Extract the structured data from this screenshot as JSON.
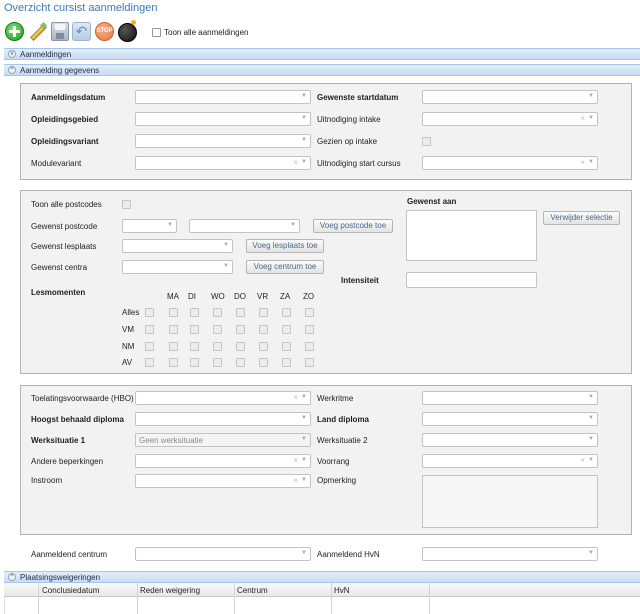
{
  "title": "Overzicht cursist aanmeldingen",
  "toolbar": {
    "icons": [
      "add-icon",
      "edit-icon",
      "save-icon",
      "undo-icon",
      "stop-icon",
      "bomb-icon"
    ],
    "stop_label": "STOP",
    "show_all_label": "Toon alle aanmeldingen"
  },
  "sections": {
    "aanmeldingen": "Aanmeldingen",
    "gegevens": "Aanmelding gegevens",
    "weigeringen": "Plaatsingsweigeringen"
  },
  "panel1": {
    "aanmeldingsdatum": "Aanmeldingsdatum",
    "opleidingsgebied": "Opleidingsgebied",
    "opleidingsvariant": "Opleidingsvariant",
    "modulevariant": "Modulevariant",
    "gewenste_startdatum": "Gewenste startdatum",
    "uitnodiging_intake": "Uitnodiging intake",
    "gezien_op_intake": "Gezien op intake",
    "uitnodiging_start": "Uitnodiging start cursus"
  },
  "panel2": {
    "toon_alle_postcodes": "Toon alle postcodes",
    "gewenst_postcode": "Gewenst postcode",
    "gewenst_lesplaats": "Gewenst lesplaats",
    "gewenst_centra": "Gewenst centra",
    "voeg_postcode": "Voeg postcode toe",
    "voeg_lesplaats": "Voeg lesplaats toe",
    "voeg_centrum": "Voeg centrum toe",
    "gewenst_aan": "Gewenst aan",
    "verwijder": "Verwijder selectie",
    "intensiteit": "Intensiteit",
    "lesmomenten": "Lesmomenten",
    "days": [
      "MA",
      "DI",
      "WO",
      "DO",
      "VR",
      "ZA",
      "ZO"
    ],
    "rows": [
      "Alles",
      "VM",
      "NM",
      "AV"
    ]
  },
  "panel3": {
    "toelatingsvoorwaarde": "Toelatingsvoorwaarde (HBO)",
    "hoogst_diploma": "Hoogst behaald diploma",
    "werksituatie1": "Werksituatie 1",
    "werksituatie1_value": "Geen werksituatie",
    "andere_beperkingen": "Andere beperkingen",
    "instroom": "Instroom",
    "werkritme": "Werkritme",
    "land_diploma": "Land diploma",
    "werksituatie2": "Werksituatie 2",
    "voorrang": "Voorrang",
    "opmerking": "Opmerking"
  },
  "bottom": {
    "aanmeldend_centrum": "Aanmeldend centrum",
    "aanmeldend_hvn": "Aanmeldend HvN"
  },
  "table": {
    "columns": [
      "Conclusiedatum",
      "Reden weigering",
      "Centrum",
      "HvN"
    ]
  }
}
